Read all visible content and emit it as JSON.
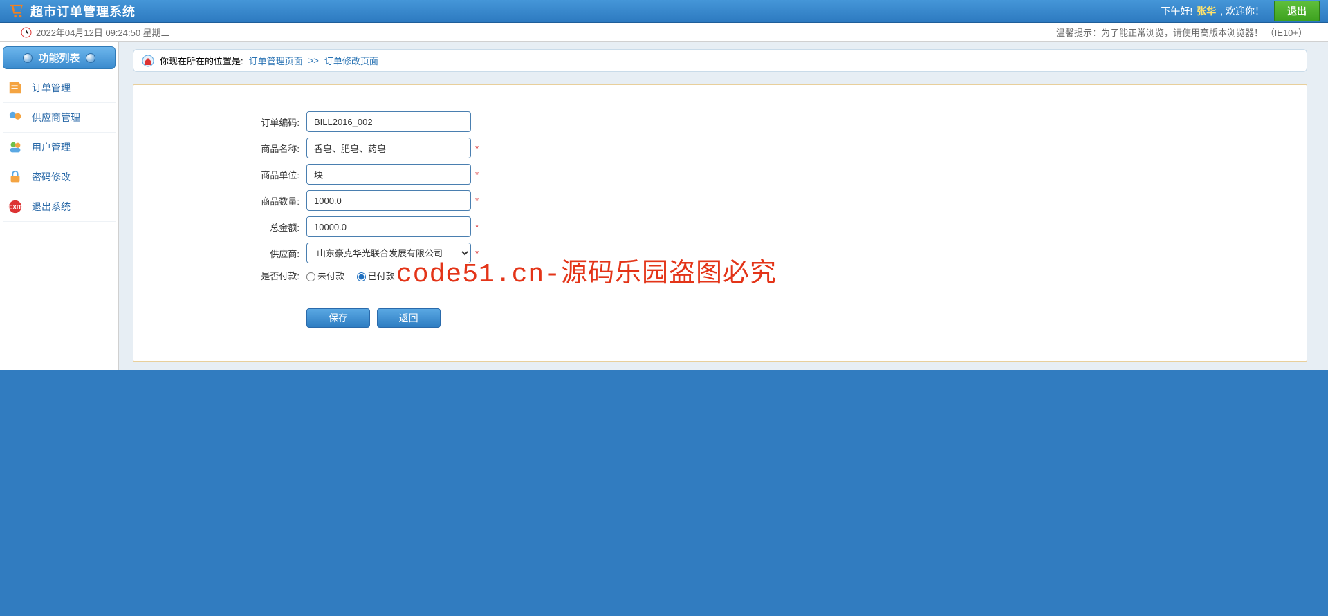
{
  "header": {
    "title": "超市订单管理系统",
    "greeting": "下午好!",
    "username": "张华",
    "welcome": ", 欢迎你！",
    "exit_label": "退出"
  },
  "subheader": {
    "datetime": "2022年04月12日 09:24:50 星期二",
    "tip": "温馨提示：为了能正常浏览，请使用高版本浏览器！ （IE10+）"
  },
  "sidebar": {
    "heading": "功能列表",
    "items": [
      {
        "label": "订单管理"
      },
      {
        "label": "供应商管理"
      },
      {
        "label": "用户管理"
      },
      {
        "label": "密码修改"
      },
      {
        "label": "退出系统"
      }
    ]
  },
  "breadcrumb": {
    "prefix": "你现在所在的位置是:",
    "link1": "订单管理页面",
    "sep": ">>",
    "link2": "订单修改页面"
  },
  "form": {
    "fields": {
      "order_code": {
        "label": "订单编码:",
        "value": "BILL2016_002"
      },
      "product_name": {
        "label": "商品名称:",
        "value": "香皂、肥皂、药皂"
      },
      "product_unit": {
        "label": "商品单位:",
        "value": "块"
      },
      "product_qty": {
        "label": "商品数量:",
        "value": "1000.0"
      },
      "total_amount": {
        "label": "总金额:",
        "value": "10000.0"
      },
      "supplier": {
        "label": "供应商:",
        "selected": "山东豪克华光联合发展有限公司"
      },
      "paid": {
        "label": "是否付款:",
        "option_unpaid": "未付款",
        "option_paid": "已付款"
      }
    },
    "buttons": {
      "save": "保存",
      "back": "返回"
    }
  },
  "watermark": "code51.cn-源码乐园盗图必究"
}
